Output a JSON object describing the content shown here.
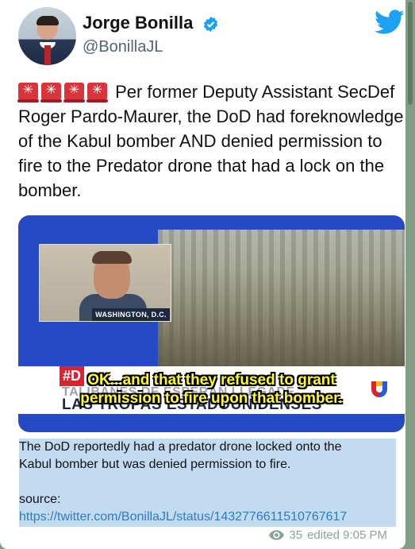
{
  "tweet": {
    "author_name": "Jorge Bonilla",
    "author_handle": "@BonillaJL",
    "verified_icon": "verified-badge-icon",
    "brand_icon": "twitter-bird-icon",
    "brand_color": "#1DA1F2",
    "alert_emojis": [
      "rotating-light-icon",
      "rotating-light-icon",
      "rotating-light-icon",
      "rotating-light-icon"
    ],
    "text": "Per former Deputy Assistant SecDef Roger Pardo-Maurer, the DoD had foreknowledge of the Kabul bomber AND denied permission to fire to the Predator drone that had a lock on the bomber."
  },
  "video": {
    "location_tag": "WASHINGTON, D.C.",
    "hashtag": "#D",
    "subtitle_line1": "OK...and that they refused to grant",
    "subtitle_line2": "permission to fire upon that bomber.",
    "chyron_top": "TALIBANES DE ESPERAN LLEGADE",
    "chyron_bottom": "LAS TROPAS ESTADOUNIDENSES",
    "network_icon": "univision-logo-icon"
  },
  "message": {
    "caption_line1": "The DoD reportedly had a predator drone locked onto the",
    "caption_line2": "Kabul bomber but was denied permission to fire.",
    "source_label": "source:",
    "source_link": "https://twitter.com/BonillaJL/status/1432776611510767617",
    "views": "35",
    "edited_label": "edited 9:05 PM"
  }
}
